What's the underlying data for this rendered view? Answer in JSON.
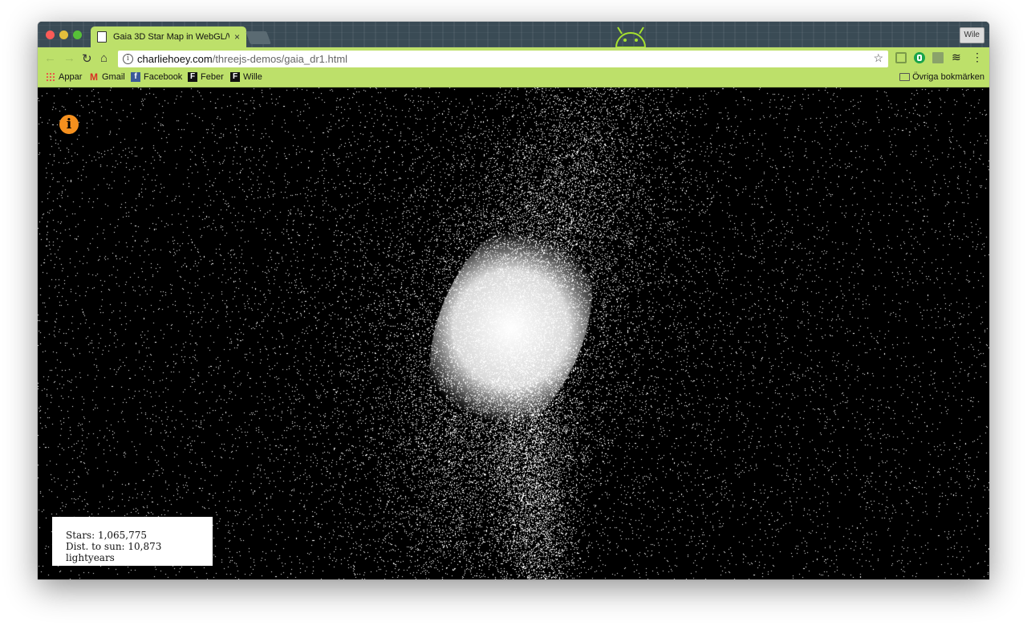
{
  "browser": {
    "tab_title": "Gaia 3D Star Map in WebGL/W",
    "tab_close": "×",
    "profile_name": "Wile",
    "url_host": "charliehoey.com",
    "url_path": "/threejs-demos/gaia_dr1.html",
    "info_glyph": "i",
    "bookmarks": [
      {
        "label": "Appar",
        "icon": "apps-grid-icon"
      },
      {
        "label": "Gmail",
        "icon": "gmail-icon"
      },
      {
        "label": "Facebook",
        "icon": "facebook-icon"
      },
      {
        "label": "Feber",
        "icon": "feber-icon"
      },
      {
        "label": "Wille",
        "icon": "feber-icon"
      }
    ],
    "other_bookmarks": "Övriga bokmärken",
    "icon_glyphs": {
      "F_fb": "f",
      "F": "F",
      "M": "M",
      "star": "☆",
      "back": "←",
      "forward": "→",
      "reload": "↻",
      "home": "⌂",
      "layers": "≋",
      "menu": "⋮"
    }
  },
  "colors": {
    "toolbar": "#bde06a",
    "info_button": "#f5901e",
    "background": "#000000"
  },
  "page": {
    "info_button_glyph": "i",
    "stats": {
      "stars": "Stars: 1,065,775",
      "distance": "Dist. to sun: 10,873 lightyears"
    }
  }
}
